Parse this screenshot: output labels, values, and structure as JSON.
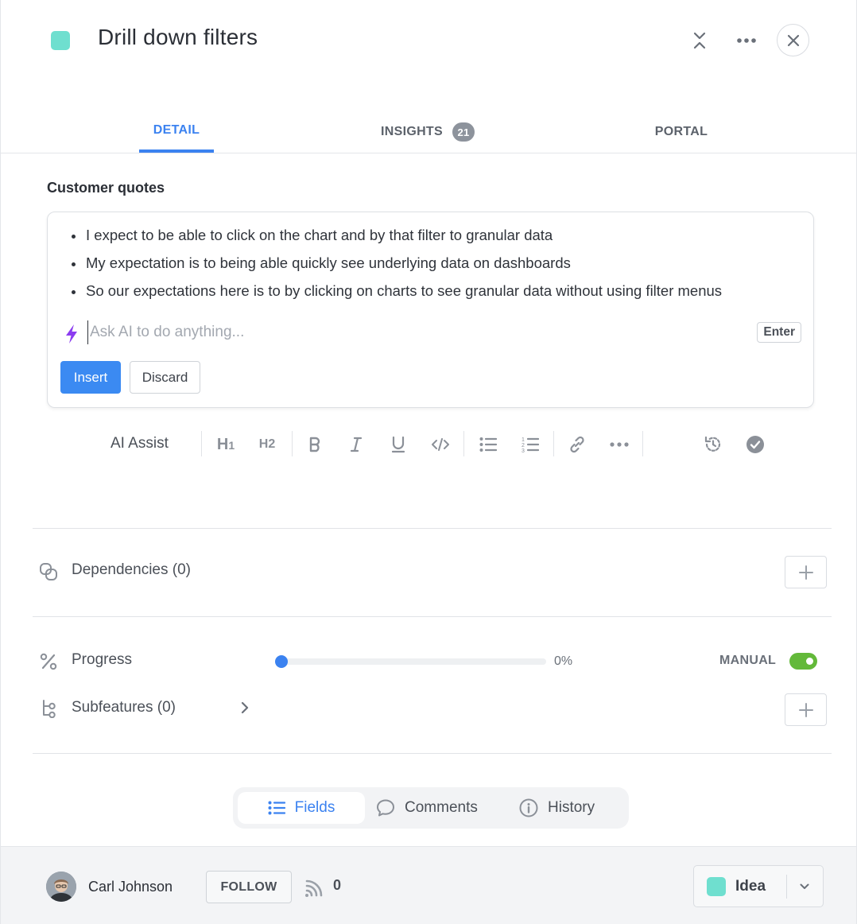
{
  "header": {
    "title": "Drill down filters",
    "status_color": "#6fdfcf"
  },
  "tabs": [
    {
      "label": "DETAIL",
      "active": true
    },
    {
      "label": "INSIGHTS",
      "badge": "21"
    },
    {
      "label": "PORTAL"
    }
  ],
  "section": {
    "label": "Customer quotes",
    "quotes": [
      "I expect to be able to click on the chart and by that filter to granular data",
      "My expectation is to being able quickly see underlying data on dashboards",
      "So our expectations here is to by clicking on charts to see granular data without using filter menus"
    ],
    "ai": {
      "placeholder": "Ask AI to do anything...",
      "enter_label": "Enter",
      "insert_label": "Insert",
      "discard_label": "Discard"
    }
  },
  "toolbar": {
    "ai_assist_label": "AI Assist",
    "h1_label": "H1",
    "h2_label": "H2",
    "icons": [
      "bold-icon",
      "italic-icon",
      "underline-icon",
      "code-icon",
      "bullet-list-icon",
      "numbered-list-icon",
      "link-icon",
      "more-icon",
      "history-icon",
      "check-circle-icon"
    ]
  },
  "dependencies": {
    "label": "Dependencies (0)"
  },
  "progress": {
    "label": "Progress",
    "value_text": "0%",
    "value": 0,
    "mode_label": "MANUAL",
    "manual_enabled": true
  },
  "subfeatures": {
    "label": "Subfeatures (0)"
  },
  "bottom_tabs": {
    "fields": "Fields",
    "comments": "Comments",
    "history": "History",
    "active": "Fields"
  },
  "footer": {
    "user_name": "Carl Johnson",
    "follow_label": "FOLLOW",
    "follower_count": "0",
    "status_label": "Idea",
    "status_color": "#6fdfcf"
  },
  "colors": {
    "accent": "#3b82f0",
    "toggle_on": "#63b93a"
  }
}
